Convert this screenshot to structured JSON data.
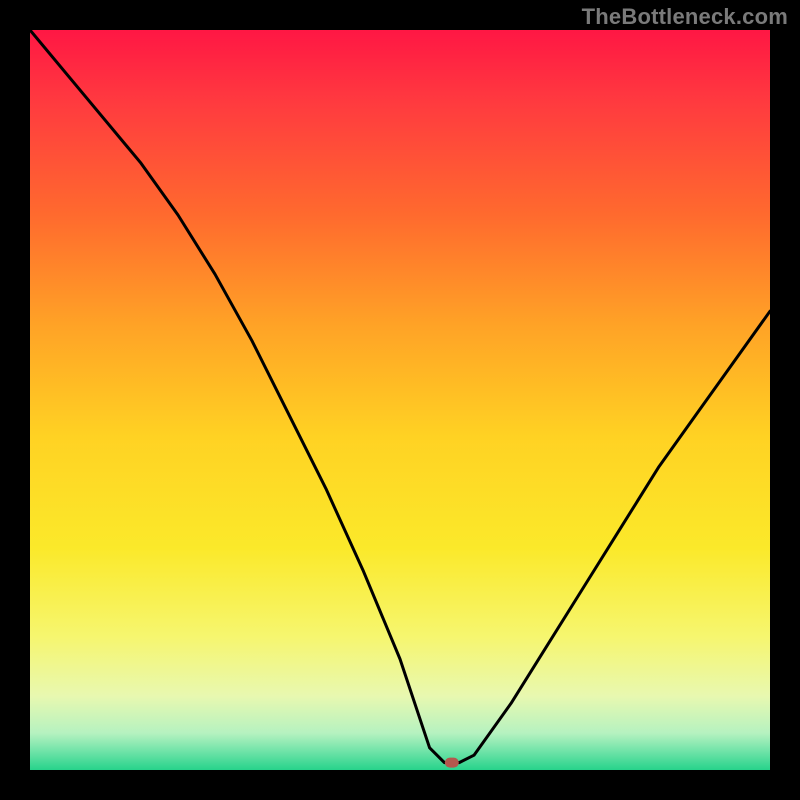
{
  "watermark": "TheBottleneck.com",
  "chart_data": {
    "type": "line",
    "title": "",
    "xlabel": "",
    "ylabel": "",
    "xlim": [
      0,
      100
    ],
    "ylim": [
      0,
      100
    ],
    "grid": false,
    "series": [
      {
        "name": "curve",
        "x": [
          0,
          5,
          10,
          15,
          20,
          25,
          30,
          35,
          40,
          45,
          50,
          54,
          56,
          58,
          60,
          65,
          70,
          75,
          80,
          85,
          90,
          95,
          100
        ],
        "y": [
          100,
          94,
          88,
          82,
          75,
          67,
          58,
          48,
          38,
          27,
          15,
          3,
          1,
          1,
          2,
          9,
          17,
          25,
          33,
          41,
          48,
          55,
          62
        ]
      }
    ],
    "marker": {
      "x": 57,
      "y": 1
    },
    "optimum_band": {
      "y_start": 0,
      "y_end": 3
    },
    "background_gradient": {
      "stops": [
        {
          "offset": 0.0,
          "color": "#ff1744"
        },
        {
          "offset": 0.1,
          "color": "#ff3b3f"
        },
        {
          "offset": 0.25,
          "color": "#ff6a2e"
        },
        {
          "offset": 0.4,
          "color": "#ffa326"
        },
        {
          "offset": 0.55,
          "color": "#ffd223"
        },
        {
          "offset": 0.7,
          "color": "#fbe92a"
        },
        {
          "offset": 0.82,
          "color": "#f6f66f"
        },
        {
          "offset": 0.9,
          "color": "#e8f8b0"
        },
        {
          "offset": 0.95,
          "color": "#b6f2c0"
        },
        {
          "offset": 0.975,
          "color": "#6fe3a8"
        },
        {
          "offset": 1.0,
          "color": "#27d38b"
        }
      ]
    }
  }
}
